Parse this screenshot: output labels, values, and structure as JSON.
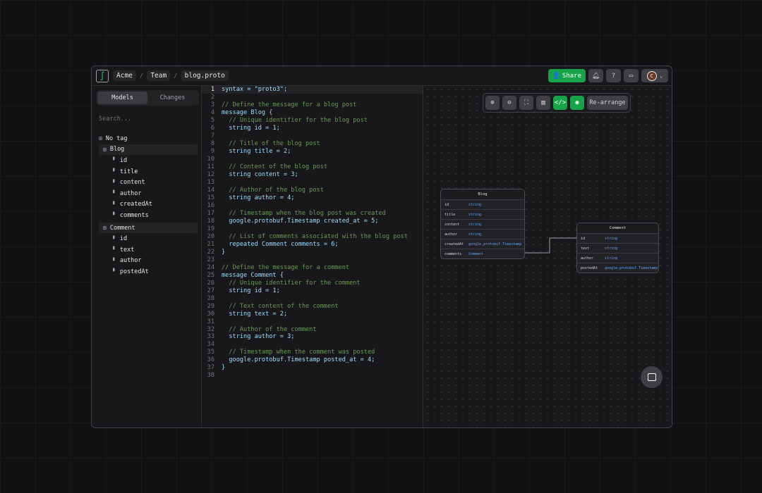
{
  "header": {
    "breadcrumb": [
      "Acme",
      "Team",
      "blog.proto"
    ],
    "share_label": "Share",
    "avatar_initial": "C"
  },
  "sidebar": {
    "tabs": [
      "Models",
      "Changes"
    ],
    "search_placeholder": "Search...",
    "no_tag": "No tag",
    "models": [
      {
        "name": "Blog",
        "fields": [
          "id",
          "title",
          "content",
          "author",
          "createdAt",
          "comments"
        ]
      },
      {
        "name": "Comment",
        "fields": [
          "id",
          "text",
          "author",
          "postedAt"
        ]
      }
    ]
  },
  "editor": {
    "current_line": 1,
    "lines": [
      "syntax = \"proto3\";",
      "",
      "// Define the message for a blog post",
      "message Blog {",
      "  // Unique identifier for the blog post",
      "  string id = 1;",
      "",
      "  // Title of the blog post",
      "  string title = 2;",
      "",
      "  // Content of the blog post",
      "  string content = 3;",
      "",
      "  // Author of the blog post",
      "  string author = 4;",
      "",
      "  // Timestamp when the blog post was created",
      "  google.protobuf.Timestamp created_at = 5;",
      "",
      "  // List of comments associated with the blog post",
      "  repeated Comment comments = 6;",
      "}",
      "",
      "// Define the message for a comment",
      "message Comment {",
      "  // Unique identifier for the comment",
      "  string id = 1;",
      "",
      "  // Text content of the comment",
      "  string text = 2;",
      "",
      "  // Author of the comment",
      "  string author = 3;",
      "",
      "  // Timestamp when the comment was posted",
      "  google.protobuf.Timestamp posted_at = 4;",
      "}",
      ""
    ]
  },
  "canvas": {
    "rearrange_label": "Re-arrange",
    "entities": [
      {
        "name": "Blog",
        "fields": [
          [
            "id",
            "string"
          ],
          [
            "title",
            "string"
          ],
          [
            "content",
            "string"
          ],
          [
            "author",
            "string"
          ],
          [
            "createdAt",
            "google.protobuf.Timestamp"
          ],
          [
            "comments",
            "Comment"
          ]
        ]
      },
      {
        "name": "Comment",
        "fields": [
          [
            "id",
            "string"
          ],
          [
            "text",
            "string"
          ],
          [
            "author",
            "string"
          ],
          [
            "postedAt",
            "google.protobuf.Timestamp"
          ]
        ]
      }
    ]
  },
  "colors": {
    "accent": "#16a34a"
  }
}
